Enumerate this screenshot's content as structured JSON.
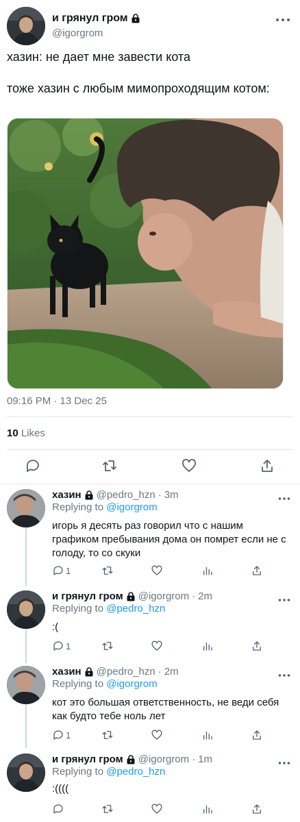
{
  "main_tweet": {
    "author_name": "и грянул гром",
    "author_handle": "@igorgrom",
    "text": "хазин: не дает мне завести кота\n\nтоже хазин с любым мимопроходящим котом:",
    "timestamp": "09:16 PM · 13 Dec 25",
    "likes_count": "10",
    "likes_label": "Likes",
    "media_alt": "photo-cat-and-man"
  },
  "replies": [
    {
      "author_name": "хазин",
      "author_handle": "@pedro_hzn",
      "time": "3m",
      "replying_prefix": "Replying to",
      "replying_to": "@igorgrom",
      "text": "игорь я десять раз говорил что с нашим графиком пребывания дома он помрет если не с голоду, то со скуки",
      "reply_count": "1"
    },
    {
      "author_name": "и грянул гром",
      "author_handle": "@igorgrom",
      "time": "2m",
      "replying_prefix": "Replying to",
      "replying_to": "@pedro_hzn",
      "text": ":(",
      "reply_count": "1"
    },
    {
      "author_name": "хазин",
      "author_handle": "@pedro_hzn",
      "time": "2m",
      "replying_prefix": "Replying to",
      "replying_to": "@igorgrom",
      "text": "кот это большая ответственность, не веди себя как будто тебе ноль лет",
      "reply_count": "1"
    },
    {
      "author_name": "и грянул гром",
      "author_handle": "@igorgrom",
      "time": "1m",
      "replying_prefix": "Replying to",
      "replying_to": "@pedro_hzn",
      "text": ":((((",
      "reply_count": ""
    }
  ],
  "separator": "·",
  "icons": {
    "lock": "lock-icon",
    "more": "more-icon",
    "reply": "reply-icon",
    "retweet": "retweet-icon",
    "like": "like-icon",
    "share": "share-icon",
    "analytics": "analytics-icon"
  },
  "colors": {
    "link": "#1d9bf0",
    "secondary_text": "#6b7780",
    "primary_text": "#0f1419"
  }
}
